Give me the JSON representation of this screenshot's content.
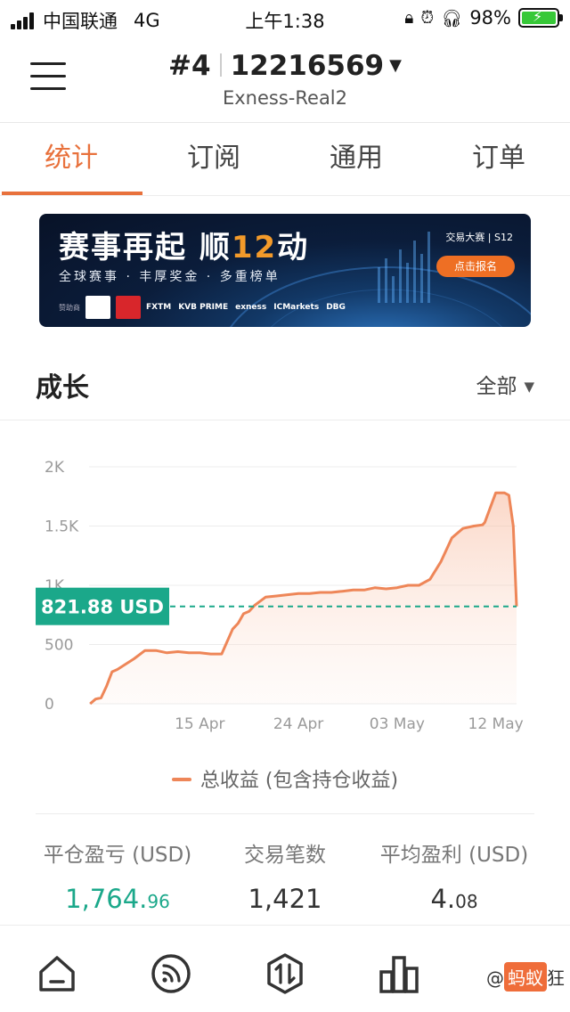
{
  "status_bar": {
    "carrier": "中国联通",
    "network": "4G",
    "time": "上午1:38",
    "battery": "98%"
  },
  "header": {
    "rank": "#4",
    "account_id": "12216569",
    "server": "Exness-Real2"
  },
  "tabs": [
    {
      "label": "统计",
      "active": true
    },
    {
      "label": "订阅",
      "active": false
    },
    {
      "label": "通用",
      "active": false
    },
    {
      "label": "订单",
      "active": false
    }
  ],
  "banner": {
    "title_a": "赛事再起 顺",
    "title_b": "12",
    "title_c": "动",
    "subtitle": "全球赛事 · 丰厚奖金 · 多重榜单",
    "brand": "交易大赛 | S12",
    "cta": "点击报名",
    "sponsor_label": "赞助商",
    "sponsors": [
      "FXTM",
      "KVB PRIME",
      "exness",
      "ICMarkets",
      "DBG"
    ]
  },
  "growth": {
    "title": "成长",
    "range": "全部"
  },
  "chart_data": {
    "type": "area",
    "yticks": [
      "0",
      "500",
      "1K",
      "1.5K",
      "2K"
    ],
    "ylim": [
      0,
      2000
    ],
    "xticks": [
      {
        "label": "15 Apr",
        "x": 10
      },
      {
        "label": "24 Apr",
        "x": 19
      },
      {
        "label": "03 May",
        "x": 28
      },
      {
        "label": "12 May",
        "x": 37
      }
    ],
    "x": [
      0,
      0.5,
      1,
      1.5,
      2,
      2.5,
      3,
      4,
      5,
      6,
      7,
      8,
      9,
      10,
      11,
      12,
      13,
      13.5,
      14,
      14.5,
      15,
      16,
      17,
      18,
      19,
      20,
      21,
      22,
      23,
      24,
      25,
      26,
      27,
      28,
      29,
      30,
      31,
      32,
      33,
      34,
      35,
      35.8,
      36,
      37,
      37.8,
      38.2,
      38.6,
      38.9
    ],
    "y": [
      0,
      40,
      50,
      150,
      270,
      290,
      320,
      380,
      450,
      450,
      430,
      440,
      430,
      430,
      420,
      420,
      630,
      680,
      760,
      780,
      830,
      900,
      910,
      920,
      930,
      930,
      940,
      940,
      950,
      960,
      960,
      980,
      970,
      980,
      1000,
      1000,
      1050,
      1200,
      1400,
      1480,
      1500,
      1510,
      1530,
      1780,
      1780,
      1760,
      1500,
      822
    ],
    "xlim": [
      -0.1,
      38.9
    ],
    "current_value": 821.88,
    "current_label": "821.88 USD",
    "series": [
      {
        "name": "总收益 (包含持仓收益)"
      }
    ],
    "colors": {
      "line": "#ee8658",
      "fill": "#f7b79a",
      "marker": "#1ba88a",
      "grid": "#ececec"
    }
  },
  "stats": [
    {
      "label": "平仓盈亏 (USD)",
      "int": "1,764.",
      "dec": "96",
      "color": "green"
    },
    {
      "label": "交易笔数",
      "int": "1,421",
      "dec": "",
      "color": "default"
    },
    {
      "label": "平均盈利 (USD)",
      "int": "4.",
      "dec": "08",
      "color": "default"
    }
  ],
  "bottom_nav": [
    {
      "icon": "home-icon"
    },
    {
      "icon": "feed-icon"
    },
    {
      "icon": "trade-icon"
    },
    {
      "icon": "bar-chart-icon"
    }
  ],
  "watermark": {
    "prefix": "@",
    "name": "蚂蚁",
    "suffix": "狂"
  }
}
